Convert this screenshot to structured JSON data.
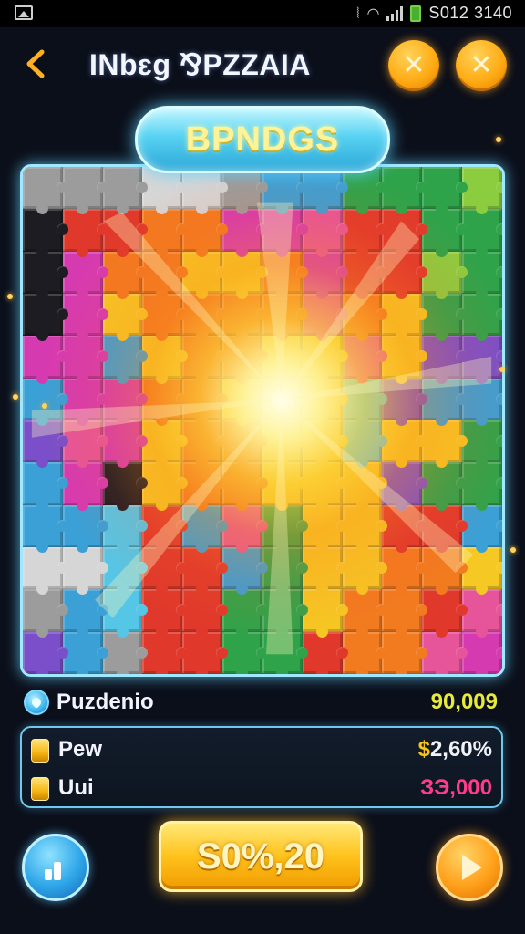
{
  "status_bar": {
    "time": "S012 3140",
    "icons": [
      "image-icon",
      "vibrate-icon",
      "wifi-icon",
      "signal-icon",
      "battery-icon"
    ],
    "battery_color": "#4cae2f"
  },
  "header": {
    "title": "INbɛg ⅋PZZAIA",
    "back_icon": "chevron-left-icon",
    "close_buttons": [
      {
        "glyph": "✕",
        "icon": "close-icon"
      },
      {
        "glyph": "✕",
        "icon": "close-icon"
      }
    ]
  },
  "banner": {
    "label": "BPNDGS"
  },
  "puzzle": {
    "rows": 12,
    "cols": 12,
    "palette": {
      "k": "#1c1c22",
      "g": "#9c9c9c",
      "r": "#e0392b",
      "o": "#f27a1f",
      "y": "#f6c823",
      "p": "#d63ab0",
      "m": "#e6559a",
      "b": "#3aa0d6",
      "c": "#56c6e6",
      "v": "#7a4fc9",
      "G": "#2fa34a",
      "l": "#8ccc3f",
      "w": "#d6d6d6"
    },
    "tiles": [
      "gggwwgbbGGGl",
      "krrooppmrrGG",
      "kpooyyoprrlG",
      "kpyoooomoyGG",
      "ppbyooyymyvv",
      "bppooyyycvbb",
      "vmpyooyycyyG",
      "bpkyooyyyvGG",
      "bbcrbmGyyrrb",
      "wwcrrbGyyooy",
      "gbcrrGGyoorm",
      "vbgrrGGroomp"
    ],
    "accent_glow": "#9fe8ff"
  },
  "stats": {
    "header": {
      "label": "Puzdenio",
      "value": "90,009",
      "icon": "gem-icon",
      "value_color": "#e7ea3a"
    },
    "rows": [
      {
        "label": "Pew",
        "dollar": "$",
        "value": "2,60%",
        "icon": "coin-icon"
      },
      {
        "label": "Uui",
        "value": "ЗЭ,000",
        "icon": "coin-icon",
        "value_color": "#ff3c8a"
      }
    ]
  },
  "bottom": {
    "main_button": "S0%,20",
    "left_icon": "bar-chart-icon",
    "right_icon": "play-icon"
  },
  "colors": {
    "background": "#0b0f1a",
    "orange_button": "#ffab14",
    "blue_button": "#2ea6e8",
    "panel_border": "#6fc9ec"
  }
}
